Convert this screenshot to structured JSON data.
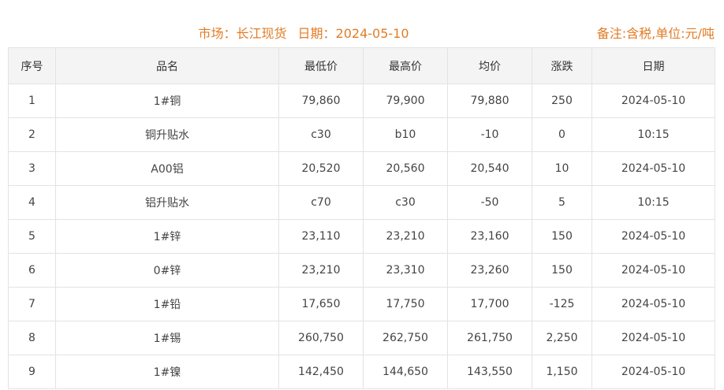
{
  "header": {
    "market_label": "市场：",
    "market_value": "长江现货",
    "date_label": "日期：",
    "date_value": "2024-05-10",
    "note": "备注:含税,单位:元/吨"
  },
  "colors": {
    "accent": "#e27c25",
    "up": "#e0161f",
    "down": "#1f8a1f",
    "flat": "#aaaaaa"
  },
  "table": {
    "columns": [
      "序号",
      "品名",
      "最低价",
      "最高价",
      "均价",
      "涨跌",
      "日期"
    ],
    "rows": [
      {
        "no": "1",
        "name": "1#铜",
        "low": "79,860",
        "high": "79,900",
        "avg": "79,880",
        "change": "250",
        "trend": "up",
        "date": "2024-05-10"
      },
      {
        "no": "2",
        "name": "铜升贴水",
        "low": "c30",
        "high": "b10",
        "avg": "-10",
        "change": "0",
        "trend": "flat",
        "date": "10:15"
      },
      {
        "no": "3",
        "name": "A00铝",
        "low": "20,520",
        "high": "20,560",
        "avg": "20,540",
        "change": "10",
        "trend": "up",
        "date": "2024-05-10"
      },
      {
        "no": "4",
        "name": "铝升贴水",
        "low": "c70",
        "high": "c30",
        "avg": "-50",
        "change": "5",
        "trend": "up",
        "date": "10:15"
      },
      {
        "no": "5",
        "name": "1#锌",
        "low": "23,110",
        "high": "23,210",
        "avg": "23,160",
        "change": "150",
        "trend": "up",
        "date": "2024-05-10"
      },
      {
        "no": "6",
        "name": "0#锌",
        "low": "23,210",
        "high": "23,310",
        "avg": "23,260",
        "change": "150",
        "trend": "up",
        "date": "2024-05-10"
      },
      {
        "no": "7",
        "name": "1#铅",
        "low": "17,650",
        "high": "17,750",
        "avg": "17,700",
        "change": "-125",
        "trend": "down",
        "date": "2024-05-10"
      },
      {
        "no": "8",
        "name": "1#锡",
        "low": "260,750",
        "high": "262,750",
        "avg": "261,750",
        "change": "2,250",
        "trend": "up",
        "date": "2024-05-10"
      },
      {
        "no": "9",
        "name": "1#镍",
        "low": "142,450",
        "high": "144,650",
        "avg": "143,550",
        "change": "1,150",
        "trend": "up",
        "date": "2024-05-10"
      }
    ]
  }
}
